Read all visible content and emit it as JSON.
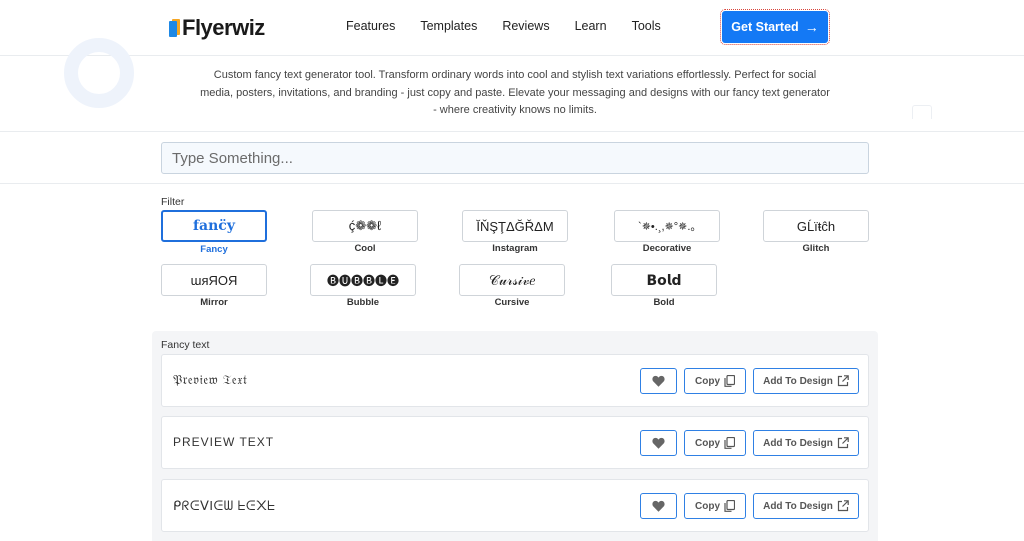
{
  "header": {
    "logo_text": "Flyerwiz",
    "nav": [
      "Features",
      "Templates",
      "Reviews",
      "Learn",
      "Tools"
    ],
    "cta_label": "Get Started"
  },
  "intro": {
    "description": "Custom fancy text generator tool. Transform ordinary words into cool and stylish text variations effortlessly. Perfect for social media, posters, invitations, and branding - just copy and paste. Elevate your messaging and designs with our fancy text generator - where creativity knows no limits."
  },
  "search": {
    "placeholder": "Type Something..."
  },
  "filter": {
    "label": "Filter",
    "options": [
      {
        "sample": "fanc̈y",
        "label": "Fancy",
        "active": true
      },
      {
        "sample": "ḉ❁❁ℓ",
        "label": "Cool",
        "active": false
      },
      {
        "sample": "ĬŇŞŢΔĞŘΔM",
        "label": "Instagram",
        "active": false
      },
      {
        "sample": "`✵•.¸,✵°✵.｡",
        "label": "Decorative",
        "active": false
      },
      {
        "sample": "GĹïŧĉh",
        "label": "Glitch",
        "active": false
      },
      {
        "sample": "ɯᴙЯOЯ",
        "label": "Mirror",
        "active": false
      },
      {
        "sample": "🅑🅤🅑🅑🅛🅔",
        "label": "Bubble",
        "active": false
      },
      {
        "sample": "𝒞𝓊𝓇𝓈𝒾𝓋𝑒",
        "label": "Cursive",
        "active": false
      },
      {
        "sample": "𝗕𝗼𝗹𝗱",
        "label": "Bold",
        "active": false
      }
    ]
  },
  "results": {
    "label": "Fancy text",
    "rows": [
      {
        "text": "𝔓𝔯𝔢𝔳𝔦𝔢𝔴 𝔗𝔢𝔵𝔱"
      },
      {
        "text": "PREVIEW TEXT"
      },
      {
        "text": "ᑭᖇᕮᐯIᕮᗯ ᖶᕮ᙭ᖶ"
      }
    ],
    "copy_label": "Copy",
    "design_label": "Add To Design"
  },
  "colors": {
    "accent": "#1479f5",
    "active_filter": "#1f6fdc"
  }
}
